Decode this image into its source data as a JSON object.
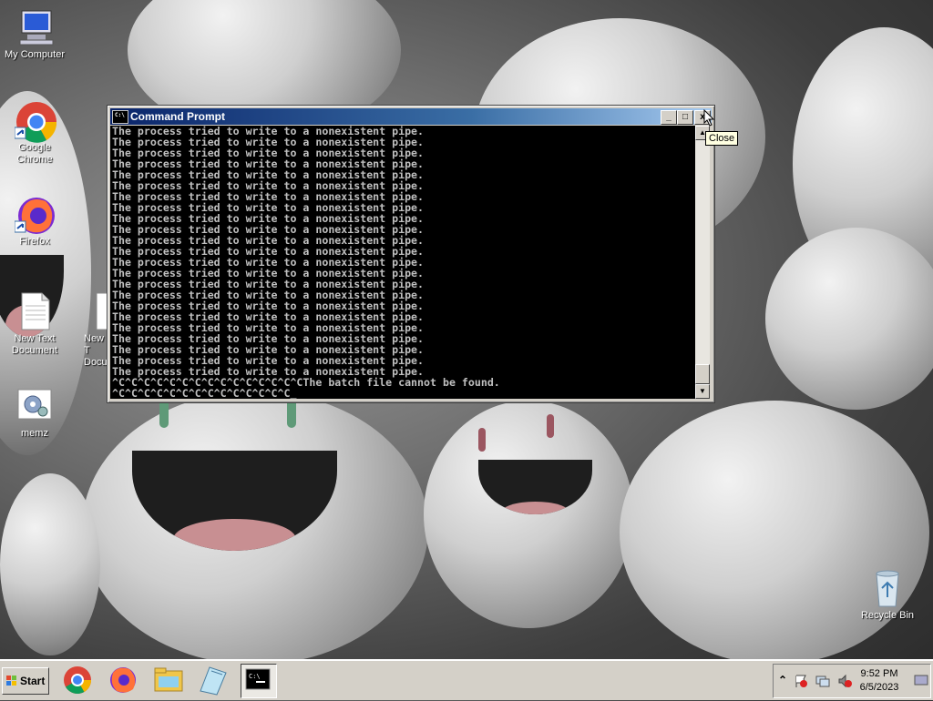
{
  "desktop": {
    "icons": [
      {
        "label": "My Computer"
      },
      {
        "label": "Google Chrome"
      },
      {
        "label": "Firefox"
      },
      {
        "label": "New Text Document"
      },
      {
        "label": "New T Docum"
      },
      {
        "label": "memz"
      },
      {
        "label": "Recycle Bin"
      }
    ]
  },
  "window": {
    "title": "Command Prompt",
    "minimize": "_",
    "maximize": "□",
    "close": "x",
    "tooltip": "Close",
    "console_lines": [
      "The process tried to write to a nonexistent pipe.",
      "The process tried to write to a nonexistent pipe.",
      "The process tried to write to a nonexistent pipe.",
      "The process tried to write to a nonexistent pipe.",
      "The process tried to write to a nonexistent pipe.",
      "The process tried to write to a nonexistent pipe.",
      "The process tried to write to a nonexistent pipe.",
      "The process tried to write to a nonexistent pipe.",
      "The process tried to write to a nonexistent pipe.",
      "The process tried to write to a nonexistent pipe.",
      "The process tried to write to a nonexistent pipe.",
      "The process tried to write to a nonexistent pipe.",
      "The process tried to write to a nonexistent pipe.",
      "The process tried to write to a nonexistent pipe.",
      "The process tried to write to a nonexistent pipe.",
      "The process tried to write to a nonexistent pipe.",
      "The process tried to write to a nonexistent pipe.",
      "The process tried to write to a nonexistent pipe.",
      "The process tried to write to a nonexistent pipe.",
      "The process tried to write to a nonexistent pipe.",
      "The process tried to write to a nonexistent pipe.",
      "The process tried to write to a nonexistent pipe.",
      "The process tried to write to a nonexistent pipe.",
      "^C^C^C^C^C^C^C^C^C^C^C^C^C^C^CThe batch file cannot be found.",
      "^C^C^C^C^C^C^C^C^C^C^C^C^C^C"
    ]
  },
  "taskbar": {
    "start_label": "Start",
    "items": [
      "chrome-icon",
      "firefox-icon",
      "folder-icon",
      "notepad-icon",
      "cmd-icon"
    ],
    "tray": {
      "time": "9:52 PM",
      "date": "6/5/2023"
    }
  },
  "colors": {
    "titlebar": "#0a246a",
    "console_bg": "#000000",
    "console_fg": "#c0c0c0",
    "taskbar": "#d4d0c8"
  }
}
